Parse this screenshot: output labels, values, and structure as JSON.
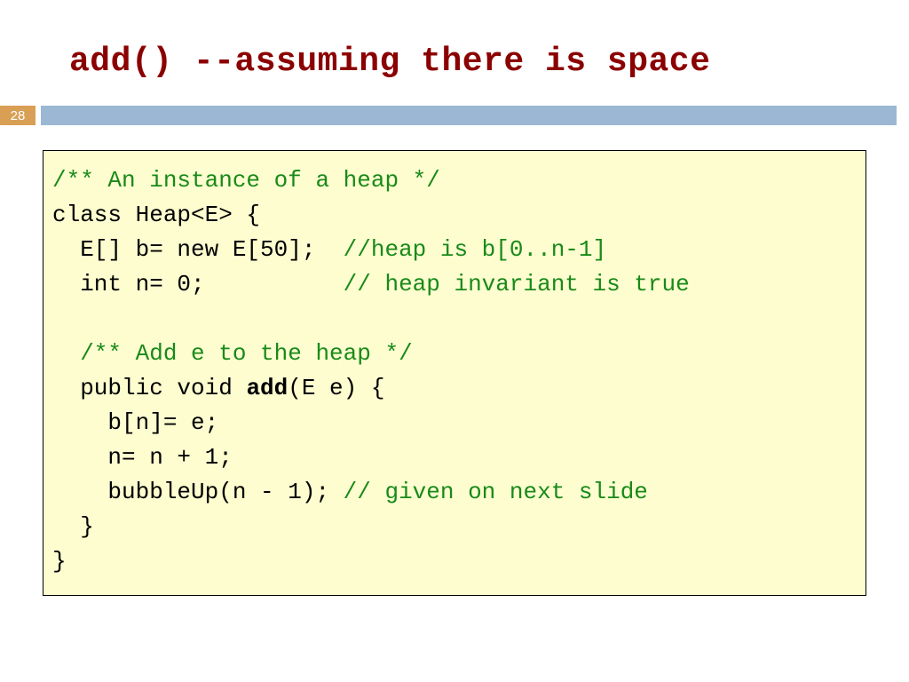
{
  "title": "add()  --assuming there is space",
  "slide_number": "28",
  "code": {
    "l1": "/** An instance of a heap */",
    "l2": "class Heap<E> {",
    "l3a": "  E[] b= new E[50];  ",
    "l3b": "//heap is b[0..n-1]",
    "l4a": "  int n= 0;          ",
    "l4b": "// heap invariant is true",
    "l5": "",
    "l6": "  /** Add e to the heap */",
    "l7a": "  public void ",
    "l7b": "add",
    "l7c": "(E e) {",
    "l8": "    b[n]= e;",
    "l9": "    n= n + 1;",
    "l10a": "    bubbleUp(n - 1); ",
    "l10b": "// given on next slide",
    "l11": "  }",
    "l12": "}"
  }
}
